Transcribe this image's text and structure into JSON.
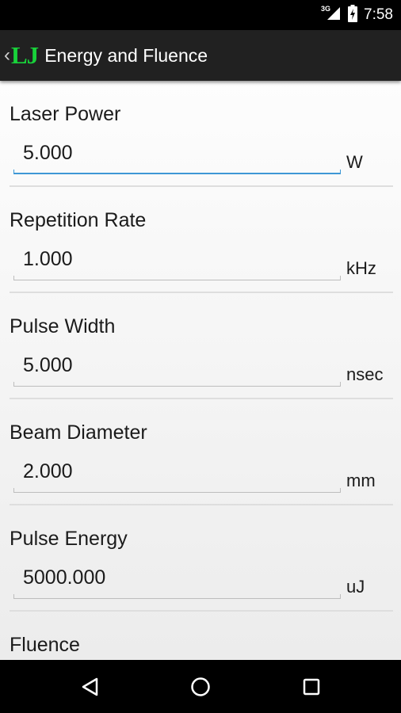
{
  "status_bar": {
    "network": "3G",
    "time": "7:58",
    "icons": [
      "signal-icon",
      "battery-charging-icon"
    ]
  },
  "app_bar": {
    "back_icon": "‹",
    "logo": "LJ",
    "title": "Energy and Fluence"
  },
  "fields": [
    {
      "label": "Laser Power",
      "value": "5.000",
      "unit": "W",
      "focused": true
    },
    {
      "label": "Repetition Rate",
      "value": "1.000",
      "unit": "kHz"
    },
    {
      "label": "Pulse Width",
      "value": "5.000",
      "unit": "nsec"
    },
    {
      "label": "Beam Diameter",
      "value": "2.000",
      "unit": "mm"
    },
    {
      "label": "Pulse Energy",
      "value": "5000.000",
      "unit": "uJ"
    },
    {
      "label": "Fluence"
    }
  ],
  "nav_bar": {
    "icons": [
      "back-triangle-icon",
      "home-circle-icon",
      "recents-square-icon"
    ]
  },
  "colors": {
    "app_bar_bg": "#212121",
    "logo_green": "#18d23a",
    "focus_blue": "#3e98d6",
    "status_bar_bg": "#000000"
  }
}
